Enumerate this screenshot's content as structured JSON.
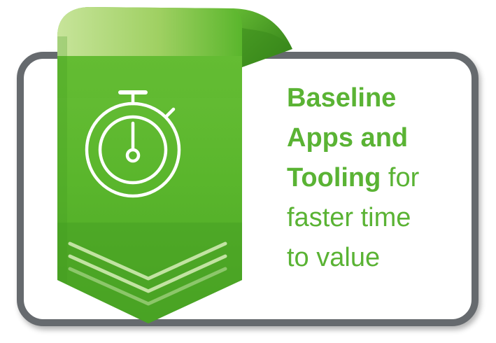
{
  "text": {
    "line1_bold": "Baseline",
    "line2_bold": "Apps and",
    "line3_bold": "Tooling",
    "line3_rest": " for",
    "line4": "faster time",
    "line5": "to value"
  },
  "colors": {
    "accent": "#5ab334",
    "frame": "#666a6e",
    "ribbon_light": "#b7dc82",
    "ribbon_main": "#5ab62c",
    "ribbon_dark": "#3f9720"
  },
  "icons": {
    "badge": "stopwatch-icon",
    "decoration": "double-chevron-down-icon"
  }
}
